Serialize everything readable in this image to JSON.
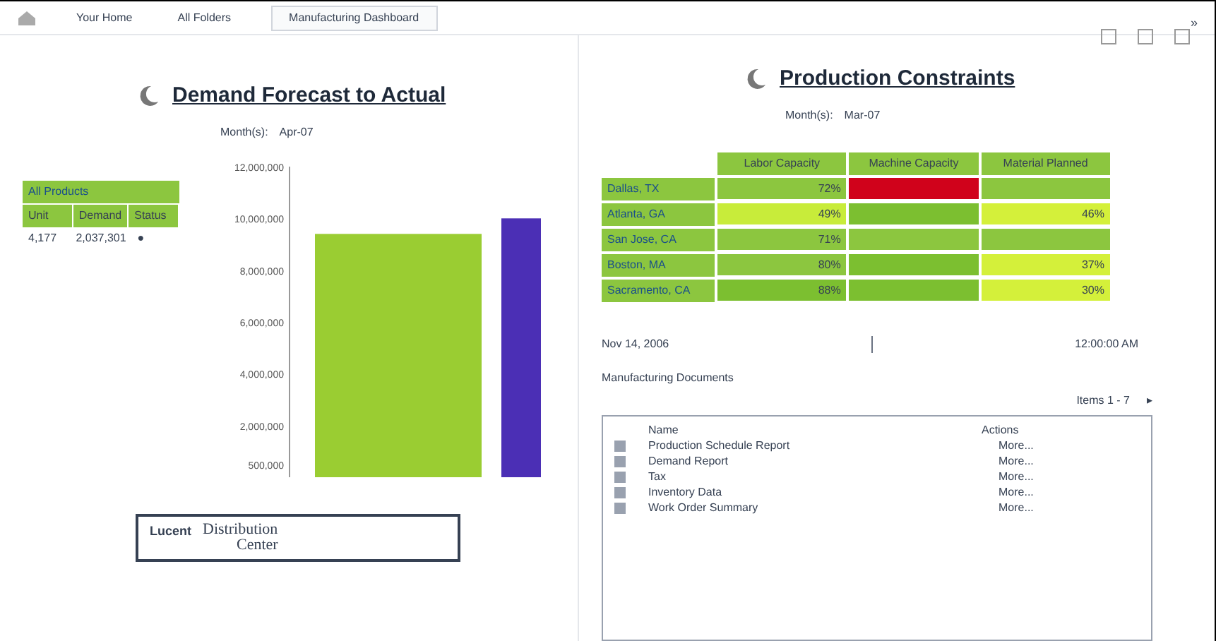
{
  "tabs": [
    {
      "label": "Your Home",
      "selected": false
    },
    {
      "label": "All Folders",
      "selected": false
    },
    {
      "label": "Manufacturing Dashboard",
      "selected": true
    }
  ],
  "expand_glyph": "»",
  "left_panel": {
    "title": "Demand Forecast to Actual",
    "filter_label": "Month(s):",
    "filter_value": "Apr-07",
    "summary_table": {
      "title": "All Products",
      "columns": [
        "Unit",
        "Demand",
        "Status"
      ],
      "rows": [
        [
          "4,177",
          "2,037,301",
          "●"
        ]
      ]
    },
    "chart_data": {
      "type": "bar",
      "categories": [
        null
      ],
      "series": [
        {
          "color": "#9acd32",
          "values": [
            9400000
          ]
        },
        {
          "color": "#4b2fb5",
          "values": [
            10000000
          ]
        }
      ],
      "ylim": [
        0,
        12000000
      ],
      "yticks": [
        {
          "value": 12000000,
          "label": "12,000,000"
        },
        {
          "value": 10000000,
          "label": "10,000,000"
        },
        {
          "value": 8000000,
          "label": "8,000,000"
        },
        {
          "value": 6000000,
          "label": "6,000,000"
        },
        {
          "value": 4000000,
          "label": "4,000,000"
        },
        {
          "value": 2000000,
          "label": "2,000,000"
        },
        {
          "value": 500000,
          "label": "500,000"
        }
      ]
    },
    "logo_text": "Distribution",
    "logo_subtext": "Center",
    "logo_label": "Lucent"
  },
  "right_panel": {
    "title": "Production Constraints",
    "filter_label": "Month(s):",
    "filter_value": "Mar-07",
    "heat_table": {
      "columns": [
        "Labor Capacity",
        "Machine Capacity",
        "Material Planned"
      ],
      "rows": [
        {
          "label": "Dallas, TX",
          "cells": [
            {
              "value": "72%",
              "color": "#8cc63f"
            },
            {
              "color": "#d0021b"
            },
            {
              "color": "#8cc63f"
            }
          ]
        },
        {
          "label": "Atlanta, GA",
          "cells": [
            {
              "value": "49%",
              "color": "#c8ec3a"
            },
            {
              "color": "#7cbf30"
            },
            {
              "value": "46%",
              "color": "#d4f03a"
            }
          ]
        },
        {
          "label": "San Jose, CA",
          "cells": [
            {
              "value": "71%",
              "color": "#8cc63f"
            },
            {
              "color": "#8cc63f"
            },
            {
              "color": "#8cc63f"
            }
          ]
        },
        {
          "label": "Boston, MA",
          "cells": [
            {
              "value": "80%",
              "color": "#8cc63f"
            },
            {
              "color": "#7cbf30"
            },
            {
              "value": "37%",
              "color": "#d4f03a"
            }
          ]
        },
        {
          "label": "Sacramento, CA",
          "cells": [
            {
              "value": "88%",
              "color": "#7cbf30"
            },
            {
              "color": "#7cbf30"
            },
            {
              "value": "30%",
              "color": "#d4f03a"
            }
          ]
        }
      ]
    },
    "date": "Nov 14, 2006",
    "time": "12:00:00 AM",
    "documents": {
      "title": "Manufacturing Documents",
      "pager": "Items 1 - 7",
      "next_glyph": "▸",
      "columns": [
        "Name",
        "Actions"
      ],
      "rows": [
        {
          "name": "Production Schedule Report",
          "action": "More..."
        },
        {
          "name": "Demand Report",
          "action": "More..."
        },
        {
          "name": "Tax",
          "action": "More..."
        },
        {
          "name": "Inventory Data",
          "action": "More..."
        },
        {
          "name": "Work Order Summary",
          "action": "More..."
        }
      ]
    }
  }
}
